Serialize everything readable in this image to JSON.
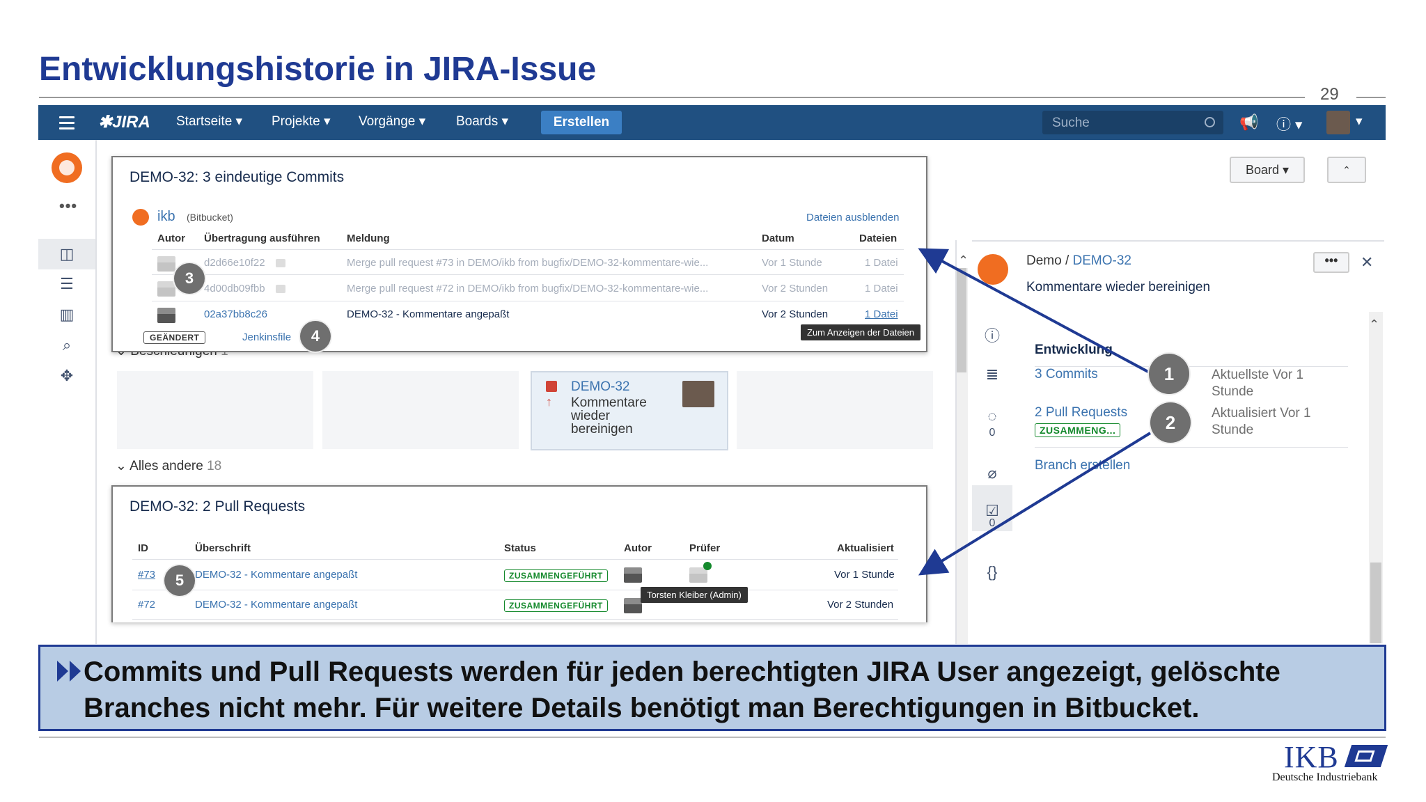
{
  "slide": {
    "title": "Entwicklungshistorie in JIRA-Issue",
    "page_number": "29",
    "caption_line1": "Commits und Pull Requests werden für jeden berechtigten JIRA User angezeigt, gelöschte",
    "caption_line2": "Branches nicht mehr. Für weitere Details benötigt man Berechtigungen in Bitbucket.",
    "footer_brand": "IKB",
    "footer_sub": "Deutsche Industriebank"
  },
  "topnav": {
    "logo": "JIRA",
    "items": [
      "Startseite",
      "Projekte",
      "Vorgänge",
      "Boards"
    ],
    "create": "Erstellen",
    "search_placeholder": "Suche"
  },
  "commits_dialog": {
    "title": "DEMO-32: 3 eindeutige Commits",
    "repo": "ikb",
    "repo_source": "(Bitbucket)",
    "hide_files": "Dateien ausblenden",
    "headers": {
      "autor": "Autor",
      "commit": "Übertragung ausführen",
      "message": "Meldung",
      "date": "Datum",
      "files": "Dateien"
    },
    "rows": [
      {
        "hash": "d2d66e10f22",
        "message": "Merge pull request #73 in DEMO/ikb from bugfix/DEMO-32-kommentare-wie...",
        "date": "Vor 1 Stunde",
        "files": "1 Datei"
      },
      {
        "hash": "4d00db09fbb",
        "message": "Merge pull request #72 in DEMO/ikb from bugfix/DEMO-32-kommentare-wie...",
        "date": "Vor 2 Stunden",
        "files": "1 Datei"
      },
      {
        "hash": "02a37bb8c26",
        "message": "DEMO-32 - Kommentare angepaßt",
        "date": "Vor 2 Stunden",
        "files": "1 Datei"
      }
    ],
    "changed_label": "GEÄNDERT",
    "changed_file": "Jenkinsfile",
    "tooltip": "Zum Anzeigen der Dateien"
  },
  "board": {
    "swimlane1": "Beschleunigen",
    "swimlane1_count": "1",
    "card_key": "DEMO-32",
    "card_summary": "Kommentare wieder bereinigen",
    "swimlane2": "Alles andere",
    "swimlane2_count": "18"
  },
  "pr_dialog": {
    "title": "DEMO-32: 2 Pull Requests",
    "headers": {
      "id": "ID",
      "title": "Überschrift",
      "status": "Status",
      "author": "Autor",
      "reviewer": "Prüfer",
      "updated": "Aktualisiert"
    },
    "rows": [
      {
        "id": "#73",
        "title": "DEMO-32 - Kommentare angepaßt",
        "status": "ZUSAMMENGEFÜHRT",
        "updated": "Vor 1 Stunde"
      },
      {
        "id": "#72",
        "title": "DEMO-32 - Kommentare angepaßt",
        "status": "ZUSAMMENGEFÜHRT",
        "updated": "Vor 2 Stunden"
      }
    ],
    "tooltip": "Torsten Kleiber (Admin)"
  },
  "right_panel": {
    "board_button": "Board",
    "project": "Demo",
    "issue_key": "DEMO-32",
    "issue_summary": "Kommentare wieder bereinigen",
    "dev_heading": "Entwicklung",
    "commits_link": "3 Commits",
    "commits_meta": "Aktuellste Vor 1 Stunde",
    "prs_link": "2 Pull Requests",
    "prs_status": "ZUSAMMENG...",
    "prs_meta": "Aktualisiert Vor 1 Stunde",
    "branch_link": "Branch erstellen",
    "comment_count": "0",
    "other_count": "0"
  },
  "callouts": [
    "1",
    "2",
    "3",
    "4",
    "5"
  ],
  "colors": {
    "nav": "#205081",
    "title": "#1f3a93",
    "caption_bg": "#b8cce4",
    "link": "#3b73af",
    "merged": "#14892c"
  }
}
